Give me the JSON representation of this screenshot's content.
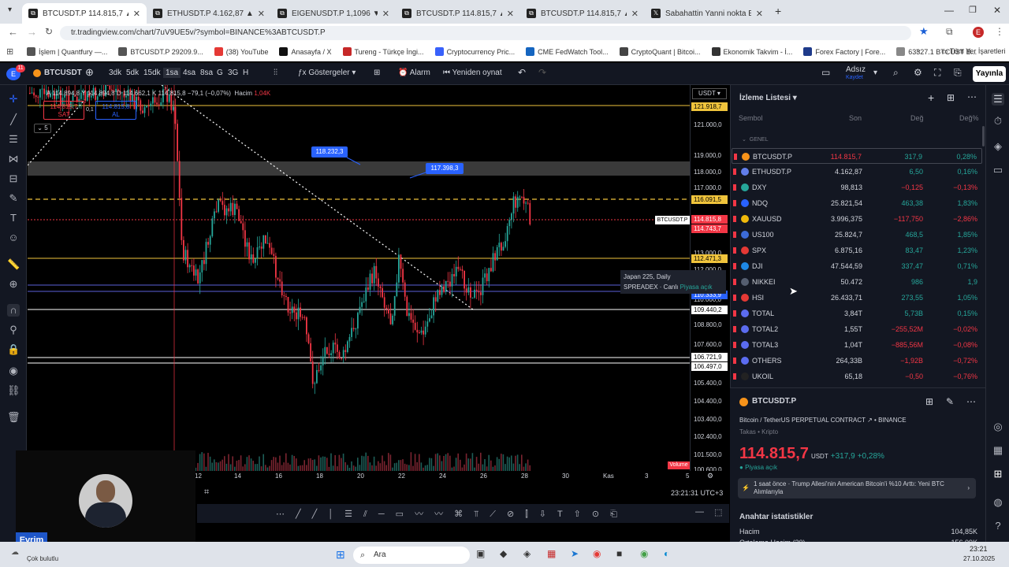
{
  "browser": {
    "tabs": [
      {
        "title": "BTCUSDT.P 114.815,7 ▲ +0.28%",
        "active": true
      },
      {
        "title": "ETHUSDT.P 4.162,87 ▲ +0.16%"
      },
      {
        "title": "EIGENUSDT.P 1,1096 ▼ −7.28%"
      },
      {
        "title": "BTCUSDT.P 114.815,7 ▲ +0.28%"
      },
      {
        "title": "BTCUSDT.P 114.815,7 ▲ +0.28%"
      },
      {
        "title": "Sabahattin Yanni nokta Etehe"
      }
    ],
    "url": "tr.tradingview.com/chart/7uV9UE5v/?symbol=BINANCE%3ABTCUSDT.P",
    "bookmarks": [
      "İşlem | Quantfury —...",
      "BTCUSDT.P 29209.9...",
      "(38) YouTube",
      "Anasayfa / X",
      "Tureng - Türkçe İngi...",
      "Cryptocurrency Pric...",
      "CME FedWatch Tool...",
      "CryptoQuant | Bitcoi...",
      "Ekonomik Takvim - İ...",
      "Forex Factory | Fore...",
      "63327.1 BTCUST B..."
    ],
    "all_bookmarks": "Tüm Yer İşaretleri",
    "profile_initial": "E"
  },
  "toolbar": {
    "symbol": "BTCUSDT",
    "timeframes": [
      "3dk",
      "5dk",
      "15dk",
      "1sa",
      "4sa",
      "8sa",
      "G",
      "3G",
      "H"
    ],
    "active_timeframe": "1sa",
    "indicators": "Göstergeler",
    "alarm": "Alarm",
    "replay": "Yeniden oynat",
    "layout_name": "Adsız",
    "layout_status": "Kaydet",
    "publish": "Yayınla",
    "avatar_initial": "E",
    "notif_count": "11"
  },
  "chart": {
    "ohlc": "A 114.894,8  Y 114.894,8  D 114.662,1  K 114.815,8  −79,1 (−0,07%)",
    "volume_label": "Hacim",
    "volume_value": "1,04K",
    "sell_price": "114.815,7",
    "sell_label": "SAT",
    "spread": "0,1",
    "buy_price": "114.815,8",
    "buy_label": "AL",
    "collapse_count": "5",
    "currency": "USDT",
    "label_a": "118.232,3",
    "label_b": "117.398,3",
    "tooltip_line1": "Japan 225, Daily",
    "tooltip_line2": "SPREADEX · Canlı",
    "tooltip_status": "Piyasa açık",
    "symbol_tag": "BTCUSDT.P",
    "price_labels": [
      "121.000,0",
      "119.000,0",
      "118.000,0",
      "117.000,0",
      "113.000,0",
      "112.000,0",
      "110.000,0",
      "108.800,0",
      "107.600,0",
      "105.400,0",
      "104.400,0",
      "103.400,0",
      "102.400,0",
      "101.500,0",
      "100.600,0"
    ],
    "price_tags": [
      {
        "text": "121.918,7",
        "color": "#f0c43c"
      },
      {
        "text": "116.091,5",
        "color": "#f0c43c"
      },
      {
        "text": "114.815,8",
        "color": "#f23645"
      },
      {
        "text": "114.743,7",
        "color": "#f23645"
      },
      {
        "text": "112.471,3",
        "color": "#f0c43c"
      },
      {
        "text": "110.333,9",
        "color": "#2962ff"
      },
      {
        "text": "109.440,2",
        "color": "#ffffff"
      },
      {
        "text": "106.721,9",
        "color": "#ffffff"
      },
      {
        "text": "106.497,0",
        "color": "#ffffff"
      }
    ],
    "volume_tag": "Volume",
    "time_labels": [
      "12",
      "14",
      "16",
      "18",
      "20",
      "22",
      "24",
      "26",
      "28",
      "30",
      "Kas",
      "3",
      "5"
    ],
    "clock": "23:21:31 UTC+3"
  },
  "watchlist": {
    "title": "İzleme Listesi",
    "columns": {
      "symbol": "Sembol",
      "last": "Son",
      "change": "Değ",
      "pct": "Değ%"
    },
    "group": "GENEL",
    "rows": [
      {
        "sym": "BTCUSDT.P",
        "last": "114.815,7",
        "chg": "317,9",
        "pct": "0,28%",
        "dir": "up",
        "icon": "#f7931a"
      },
      {
        "sym": "ETHUSDT.P",
        "last": "4.162,87",
        "chg": "6,50",
        "pct": "0,16%",
        "dir": "up",
        "icon": "#627eea"
      },
      {
        "sym": "DXY",
        "last": "98,813",
        "chg": "−0,125",
        "pct": "−0,13%",
        "dir": "dn",
        "icon": "#26a69a"
      },
      {
        "sym": "NDQ",
        "last": "25.821,54",
        "chg": "463,38",
        "pct": "1,83%",
        "dir": "up",
        "icon": "#2962ff"
      },
      {
        "sym": "XAUUSD",
        "last": "3.996,375",
        "chg": "−117,750",
        "pct": "−2,86%",
        "dir": "dn",
        "icon": "#f0b90b"
      },
      {
        "sym": "US100",
        "last": "25.824,7",
        "chg": "468,5",
        "pct": "1,85%",
        "dir": "up",
        "icon": "#3c6bd8"
      },
      {
        "sym": "SPX",
        "last": "6.875,16",
        "chg": "83,47",
        "pct": "1,23%",
        "dir": "up",
        "icon": "#e53935"
      },
      {
        "sym": "DJI",
        "last": "47.544,59",
        "chg": "337,47",
        "pct": "0,71%",
        "dir": "up",
        "icon": "#1e88e5"
      },
      {
        "sym": "NIKKEI",
        "last": "50.472",
        "chg": "986",
        "pct": "1,9",
        "dir": "up",
        "icon": "#555e70"
      },
      {
        "sym": "HSI",
        "last": "26.433,71",
        "chg": "273,55",
        "pct": "1,05%",
        "dir": "up",
        "icon": "#e53935"
      },
      {
        "sym": "TOTAL",
        "last": "3,84T",
        "chg": "5,73B",
        "pct": "0,15%",
        "dir": "up",
        "icon": "#5b6cf0"
      },
      {
        "sym": "TOTAL2",
        "last": "1,55T",
        "chg": "−255,52M",
        "pct": "−0,02%",
        "dir": "dn",
        "icon": "#5b6cf0"
      },
      {
        "sym": "TOTAL3",
        "last": "1,04T",
        "chg": "−885,56M",
        "pct": "−0,08%",
        "dir": "dn",
        "icon": "#5b6cf0"
      },
      {
        "sym": "OTHERS",
        "last": "264,33B",
        "chg": "−1,92B",
        "pct": "−0,72%",
        "dir": "dn",
        "icon": "#5b6cf0"
      },
      {
        "sym": "UKOIL",
        "last": "65,18",
        "chg": "−0,50",
        "pct": "−0,76%",
        "dir": "dn",
        "icon": "#222"
      }
    ]
  },
  "details": {
    "symbol": "BTCUSDT.P",
    "full_name": "Bitcoin / TetherUS PERPETUAL CONTRACT",
    "exchange": "BINANCE",
    "category": "Takas • Kripto",
    "price": "114.815,7",
    "currency": "USDT",
    "change": "+317,9",
    "pct": "+0,28%",
    "market_status": "Piyasa açık",
    "news_time": "1 saat önce",
    "news_text": "Trump Allesi'nin American Bitcoin'i %10 Arttı: Yeni BTC Alımlarıyla",
    "key_stats": "Anahtar istatistikler",
    "volume_label": "Hacim",
    "volume_value": "104,85K",
    "avg_volume_label": "Ortalama Hacim (30)",
    "avg_volume_value": "156,09K"
  },
  "webcam": {
    "name": "Evrim"
  },
  "taskbar": {
    "weather": "Çok bulutlu",
    "search": "Ara",
    "time": "23:21",
    "date": "27.10.2025"
  }
}
